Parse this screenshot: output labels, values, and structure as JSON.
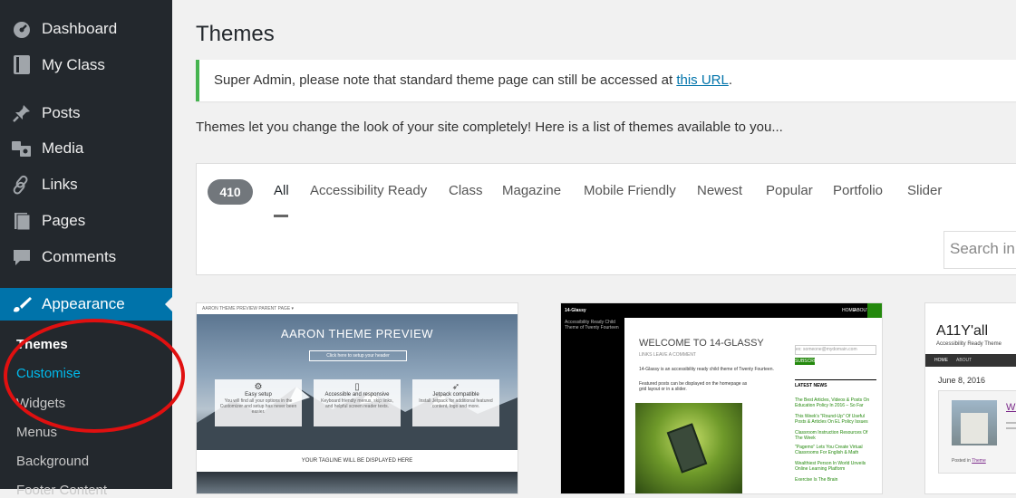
{
  "sidebar": {
    "items": [
      {
        "label": "Dashboard",
        "icon": "dashboard-icon"
      },
      {
        "label": "My Class",
        "icon": "book-icon"
      },
      {
        "label": "Posts",
        "icon": "pin-icon"
      },
      {
        "label": "Media",
        "icon": "media-icon"
      },
      {
        "label": "Links",
        "icon": "link-icon"
      },
      {
        "label": "Pages",
        "icon": "pages-icon"
      },
      {
        "label": "Comments",
        "icon": "comment-icon"
      },
      {
        "label": "Appearance",
        "icon": "brush-icon"
      }
    ],
    "submenu": [
      "Themes",
      "Customise",
      "Widgets",
      "Menus",
      "Background",
      "Footer Content"
    ]
  },
  "page": {
    "title": "Themes",
    "notice_prefix": "Super Admin, please note that standard theme page can still be accessed at ",
    "notice_link": "this URL",
    "notice_suffix": ".",
    "intro": "Themes let you change the look of your site completely! Here is a list of themes available to you..."
  },
  "filter": {
    "count": "410",
    "tabs": [
      "All",
      "Accessibility Ready",
      "Class",
      "Magazine",
      "Mobile Friendly",
      "Newest",
      "Popular",
      "Portfolio",
      "Slider"
    ],
    "search_placeholder": "Search in"
  },
  "themes": [
    {
      "topbar": "AARON THEME PREVIEW   PARENT PAGE ▾",
      "hero_title": "AARON THEME PREVIEW",
      "hero_button": "Click here to setup your header",
      "features": [
        {
          "title": "Easy setup",
          "text": "You will find all your options in the Customizer and setup has never been easier."
        },
        {
          "title": "Accessible and responsive",
          "text": "Keyboard friendly menus, skip links, and helpful screen reader texts."
        },
        {
          "title": "Jetpack compatible",
          "text": "Install Jetpack for additional featured content, logo and more."
        }
      ],
      "tagline": "YOUR TAGLINE WILL BE DISPLAYED HERE"
    },
    {
      "site_title": "14-Glassy",
      "site_desc": "Accessibility Ready Child Theme of Twenty Fourteen",
      "nav": [
        "HOME",
        "ABOUT"
      ],
      "welcome": "WELCOME TO 14-GLASSY",
      "meta": "LINKS   LEAVE A COMMENT",
      "body1": "14-Glassy is an accessibility ready child theme of Twenty Fourteen.",
      "body2": "Featured posts can be displayed on the homepage as grid layout or in a slider.",
      "email_placeholder": "ex: someone@mydomain.com",
      "subscribe": "SUBSCRIBE",
      "latest_news": "LATEST NEWS",
      "news": [
        "The Best Articles, Videos & Posts On Education Policy In 2016 – So Far",
        "This Week's \"Round-Up\" Of Useful Posts & Articles On EL Policy Issues",
        "Classroom Instruction Resources Of The Week",
        "\"Pagemo\" Lets You Create Virtual Classrooms For English & Math",
        "Wealthiest Person In World Unveils Online Learning Platform",
        "Exercise Is The Brain"
      ]
    },
    {
      "title": "A11Y'all",
      "subtitle": "Accessibility Ready Theme",
      "nav": [
        "HOME",
        "ABOUT"
      ],
      "date": "June 8, 2016",
      "posted": "Posted in",
      "posted_link": "Theme"
    }
  ],
  "colors": {
    "sidebar_bg": "#23282d",
    "active_bg": "#0073aa",
    "notice_border": "#46b450",
    "annotation_circle": "#e01010"
  }
}
